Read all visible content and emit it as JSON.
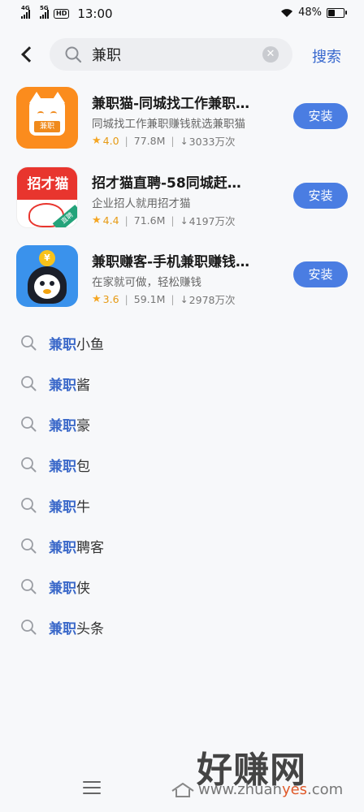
{
  "status_bar": {
    "signal_1": "4G",
    "signal_2": "5G",
    "hd": "HD",
    "time": "13:00",
    "battery_text": "48%",
    "battery_level": 0.48
  },
  "search": {
    "query": "兼职",
    "submit_label": "搜索",
    "clear_glyph": "✕"
  },
  "apps": [
    {
      "title": "兼职猫-同城找工作兼职…",
      "desc": "同城找工作兼职赚钱就选兼职猫",
      "rating": "4.0",
      "size": "77.8M",
      "downloads": "3033万次",
      "install_label": "安装",
      "icon_badge": "兼职",
      "icon": "cat-icon"
    },
    {
      "title": "招才猫直聘-58同城赶…",
      "desc": "企业招人就用招才猫",
      "rating": "4.4",
      "size": "71.6M",
      "downloads": "4197万次",
      "install_label": "安装",
      "icon_text": "招才猫",
      "icon_tag": "直聘",
      "icon": "lucky-cat-icon"
    },
    {
      "title": "兼职赚客-手机兼职赚钱…",
      "desc": "在家就可做，轻松赚钱",
      "rating": "3.6",
      "size": "59.1M",
      "downloads": "2978万次",
      "install_label": "安装",
      "icon_coin": "¥",
      "icon": "penguin-icon"
    }
  ],
  "suggestions": [
    {
      "highlight": "兼职",
      "rest": "小鱼"
    },
    {
      "highlight": "兼职",
      "rest": "酱"
    },
    {
      "highlight": "兼职",
      "rest": "豪"
    },
    {
      "highlight": "兼职",
      "rest": "包"
    },
    {
      "highlight": "兼职",
      "rest": "牛"
    },
    {
      "highlight": "兼职",
      "rest": "聘客"
    },
    {
      "highlight": "兼职",
      "rest": "侠"
    },
    {
      "highlight": "兼职",
      "rest": "头条"
    }
  ],
  "meta": {
    "separator": "|",
    "download_glyph": "↓",
    "star_glyph": "★"
  },
  "watermark": {
    "logo": "好赚网",
    "url_a": "www.zhuan",
    "url_b": "yes",
    "url_c": ".com"
  },
  "colors": {
    "accent": "#4a7de2",
    "link": "#3667ce",
    "star": "#f5a623"
  }
}
